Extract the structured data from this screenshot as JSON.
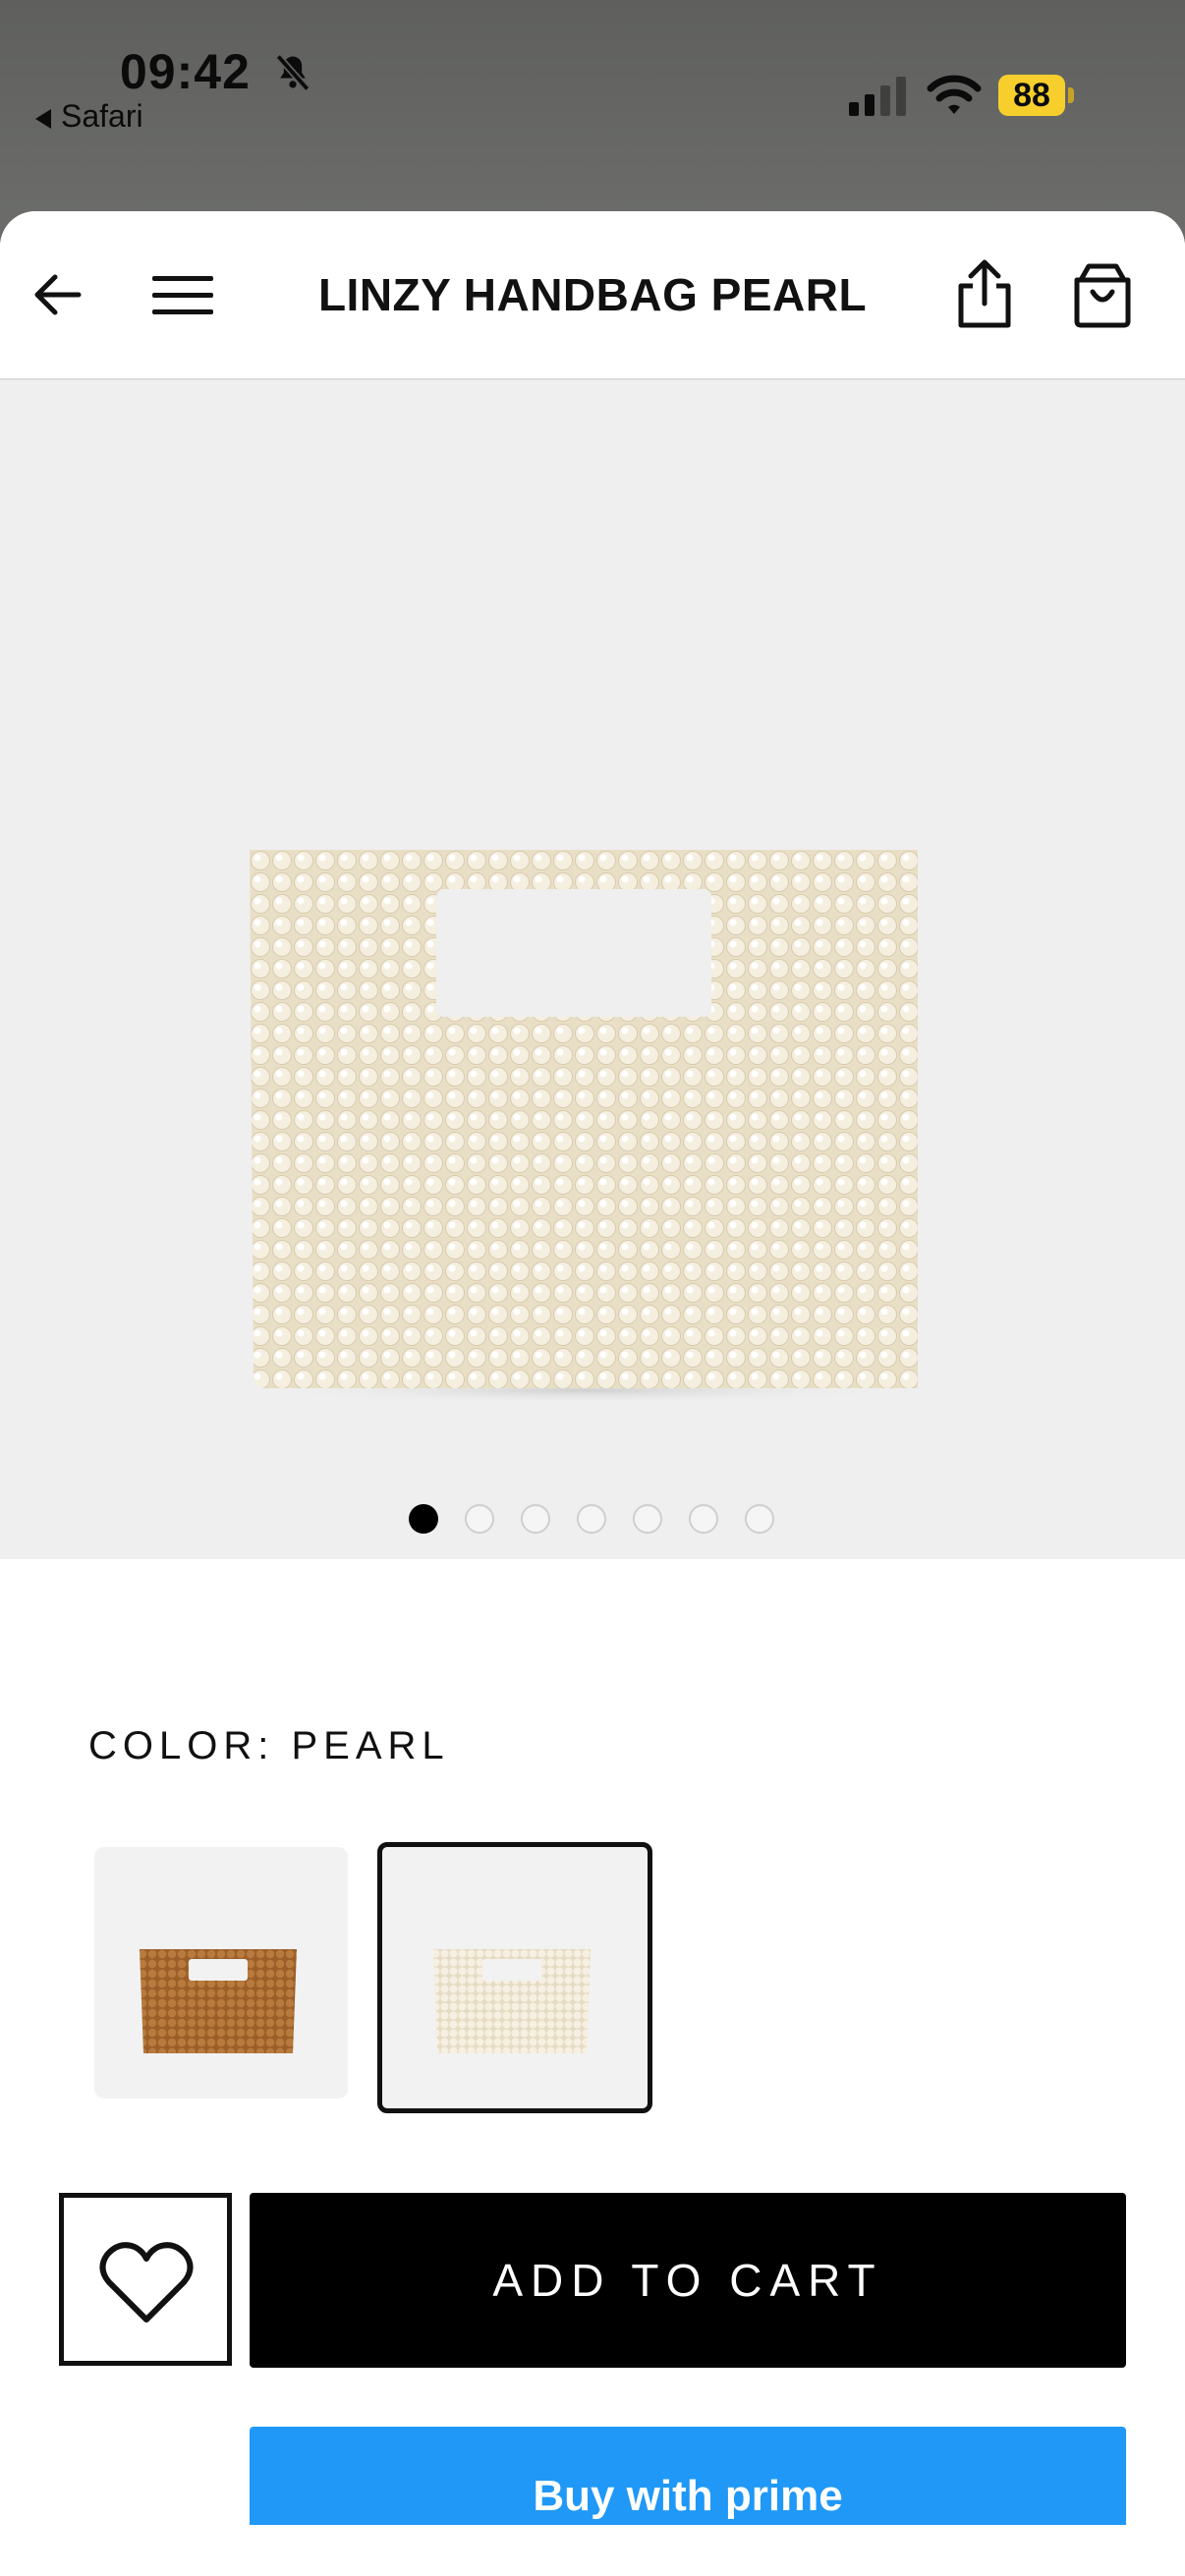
{
  "status_bar": {
    "time": "09:42",
    "back_app_label": "Safari",
    "battery_level": "88",
    "battery_color": "#f7cf2c",
    "icons": [
      "bell-slash-icon",
      "cellular-signal-icon",
      "wifi-icon",
      "battery-icon"
    ]
  },
  "nav": {
    "title": "LINZY HANDBAG PEARL",
    "icons": [
      "back-arrow-icon",
      "menu-icon",
      "share-icon",
      "shopping-bag-icon"
    ]
  },
  "gallery": {
    "image_count": 7,
    "active_index": 0
  },
  "product": {
    "color_label": "COLOR: PEARL",
    "swatches": [
      {
        "name": "wood",
        "selected": false
      },
      {
        "name": "pearl",
        "selected": true
      }
    ]
  },
  "actions": {
    "add_to_cart": "ADD TO CART",
    "buy_with_prime": "Buy with prime",
    "prime_color": "#1f98f7"
  }
}
